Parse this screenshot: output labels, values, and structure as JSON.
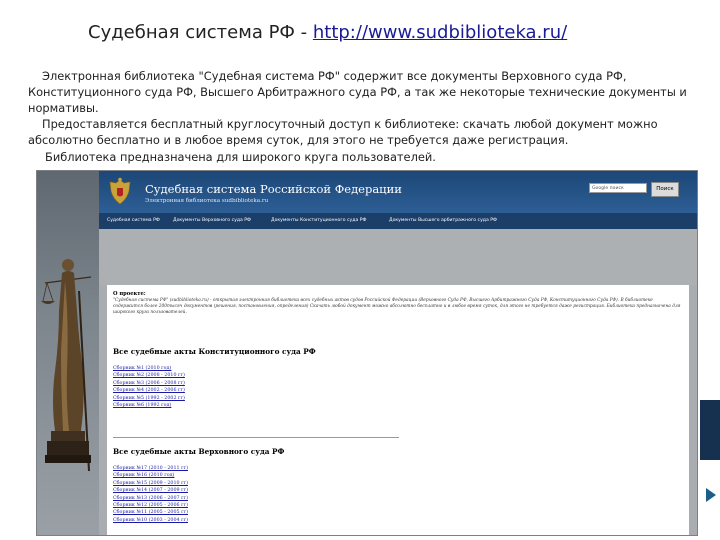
{
  "slide": {
    "title_prefix": "Судебная система РФ  - ",
    "title_link": "http://www.sudbiblioteka.ru/",
    "paragraph1": "Электронная библиотека \"Судебная система РФ\" содержит все документы Верховного суда РФ, Конституционного суда РФ, Высшего Арбитражного суда РФ, а так же некоторые технические документы и нормативы.",
    "paragraph2": "Предоставляется бесплатный круглосуточный доступ к библиотеке: скачать любой документ можно абсолютно бесплатно и в любое время суток, для этого не требуется даже регистрация.",
    "paragraph3": "Библиотека предназначена для широкого круга пользователей."
  },
  "site": {
    "name": "Судебная система Российской Федерации",
    "subtitle": "Электронная библиотека sudbiblioteka.ru",
    "search_placeholder": "Google поиск",
    "search_button": "Поиск",
    "nav": [
      "Судебная система РФ",
      "Документы Верховного суда РФ",
      "Документы Конституционного суда РФ",
      "Документы Высшего арбитражного суда РФ"
    ],
    "about_label": "О проекте:",
    "about_text": "\"Судебная система РФ\" (sudbiblioteka.ru) - открытая электронная библиотека всех судебных актов судов Российской Федерации (Верховного Суда РФ, Высшего Арбитражного Суда РФ, Конституционного Суда РФ). В библиотеке содержится более 200тысяч документов (решения, постановления, определения) Скачать любой документ можно абсолютно бесплатно и в любое время суток, для этого не требуется даже регистрация. Библиотека предназначена для широкого круга пользователей.",
    "section1_title": "Все судебные акты Конституционного суда РФ",
    "section1_links": [
      "Сборник №1 (2010 год)",
      "Сборник №2 (2008 - 2010 гг)",
      "Сборник №3 (2006 - 2008 гг)",
      "Сборник №4 (2002 - 2006 гг)",
      "Сборник №5 (1992 - 2002 гг)",
      "Сборник №6 (1992 год)"
    ],
    "section2_title": "Все судебные акты Верховного суда РФ",
    "section2_links": [
      "Сборник №17 (2010 - 2011 гг)",
      "Сборник №16 (2010 год)",
      "Сборник №15 (2009 - 2010 гг)",
      "Сборник №14 (2007 - 2009 гг)",
      "Сборник №13 (2006 - 2007 гг)",
      "Сборник №12 (2005 - 2006 гг)",
      "Сборник №11 (2005 - 2005 гг)",
      "Сборник №10 (2003 - 2004 гг)"
    ]
  },
  "colors": {
    "header_blue": "#1c4777",
    "nav_blue": "#1c3f6a",
    "link_blue": "#1a1aa8",
    "accent_arrow": "#1b5e8c"
  }
}
